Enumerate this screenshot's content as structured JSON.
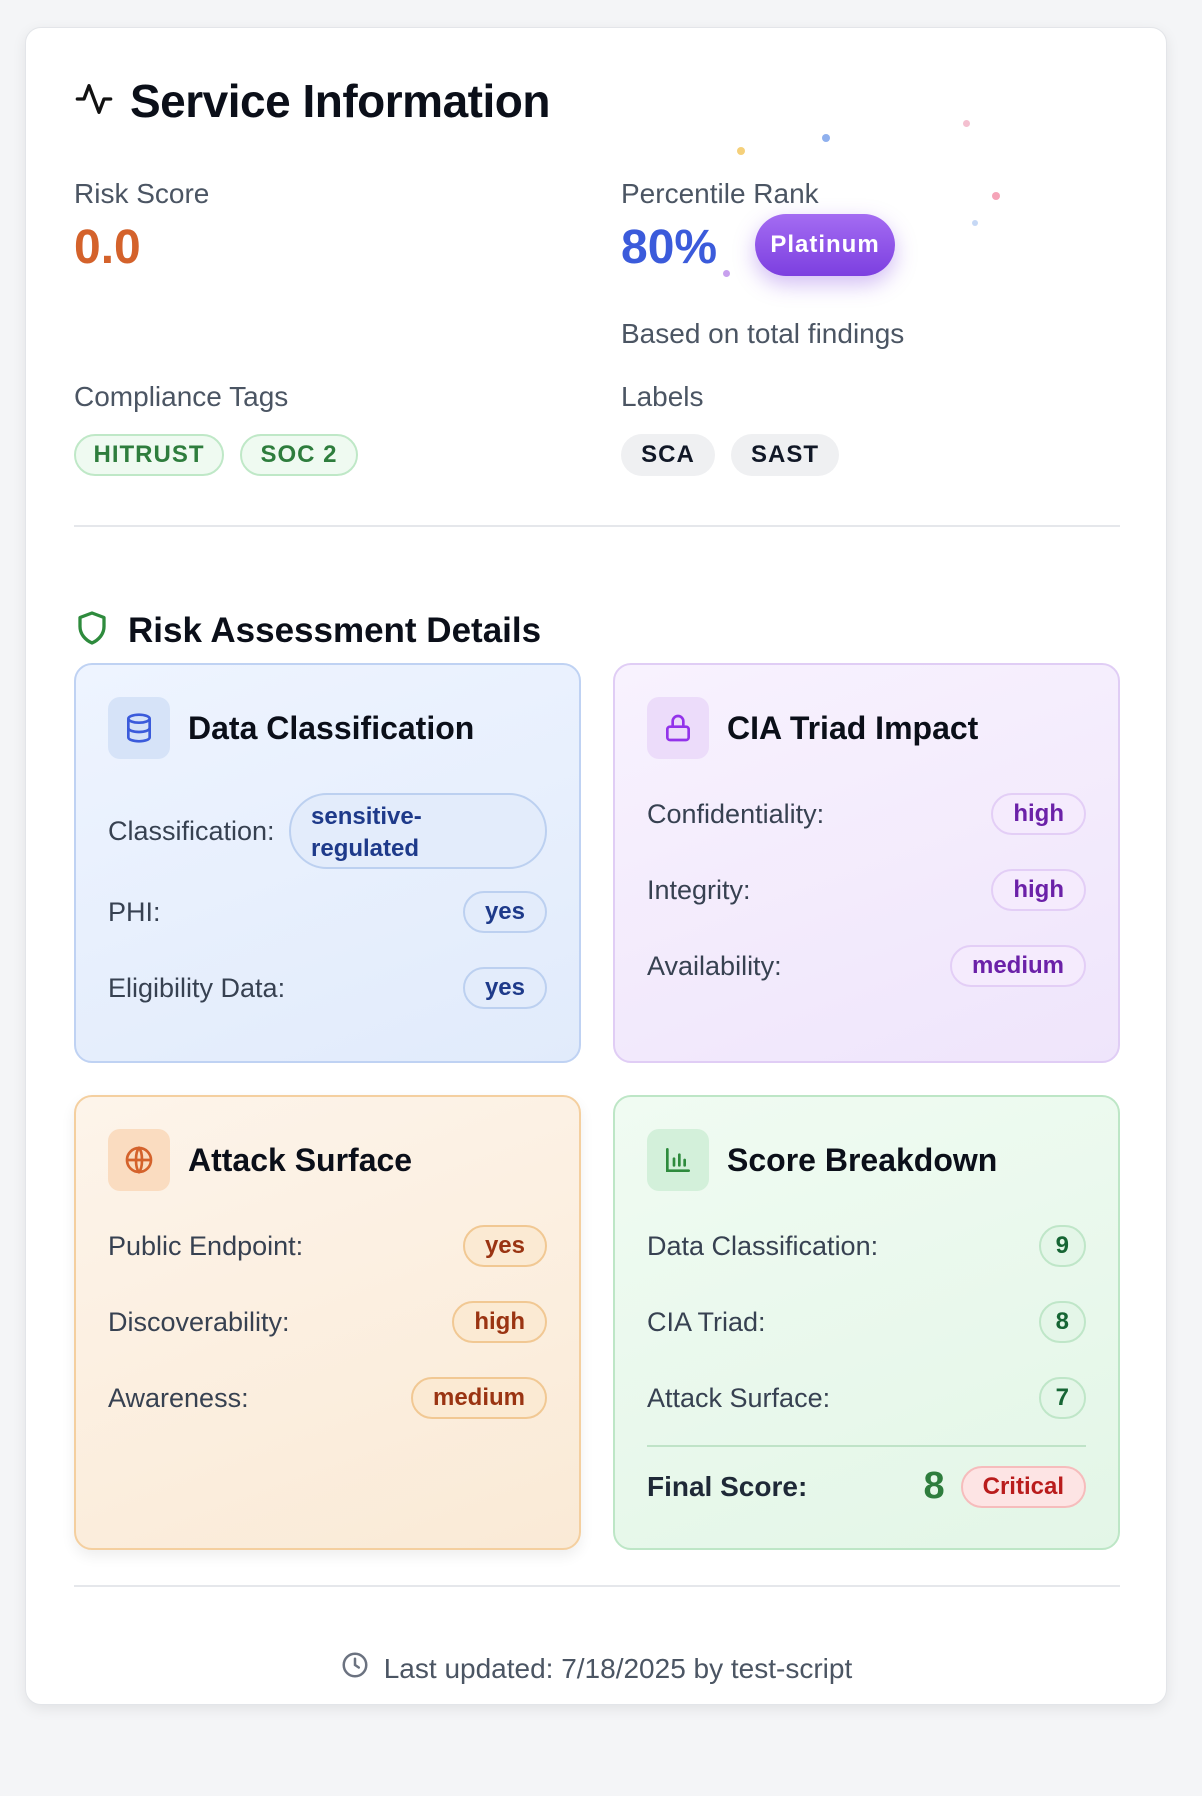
{
  "header": {
    "title": "Service Information",
    "icon": "activity-icon"
  },
  "risk_score": {
    "label": "Risk Score",
    "value": "0.0",
    "color": "#d4622b"
  },
  "percentile": {
    "label": "Percentile Rank",
    "value": "80%",
    "tier": "Platinum",
    "note": "Based on total findings"
  },
  "compliance": {
    "label": "Compliance Tags",
    "tags": [
      "HITRUST",
      "SOC 2"
    ]
  },
  "labels": {
    "label": "Labels",
    "items": [
      "SCA",
      "SAST"
    ]
  },
  "assessment": {
    "title": "Risk Assessment Details",
    "icon": "shield-icon"
  },
  "data_classification": {
    "title": "Data Classification",
    "icon": "database-icon",
    "classification_label": "Classification:",
    "classification_value": "sensitive-regulated",
    "phi_label": "PHI:",
    "phi_value": "yes",
    "eligibility_label": "Eligibility Data:",
    "eligibility_value": "yes"
  },
  "cia": {
    "title": "CIA Triad Impact",
    "icon": "lock-icon",
    "rows": [
      {
        "label": "Confidentiality:",
        "value": "high"
      },
      {
        "label": "Integrity:",
        "value": "high"
      },
      {
        "label": "Availability:",
        "value": "medium"
      }
    ]
  },
  "attack_surface": {
    "title": "Attack Surface",
    "icon": "globe-icon",
    "rows": [
      {
        "label": "Public Endpoint:",
        "value": "yes"
      },
      {
        "label": "Discoverability:",
        "value": "high"
      },
      {
        "label": "Awareness:",
        "value": "medium"
      }
    ]
  },
  "score_breakdown": {
    "title": "Score Breakdown",
    "icon": "bar-chart-icon",
    "rows": [
      {
        "label": "Data Classification:",
        "value": "9"
      },
      {
        "label": "CIA Triad:",
        "value": "8"
      },
      {
        "label": "Attack Surface:",
        "value": "7"
      }
    ],
    "final_label": "Final Score:",
    "final_value": "8",
    "severity": "Critical"
  },
  "footer": {
    "text": "Last updated: 7/18/2025 by test-script",
    "icon": "clock-icon"
  }
}
